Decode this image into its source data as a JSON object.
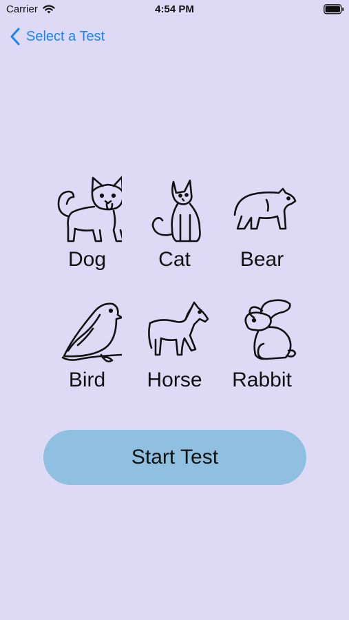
{
  "status_bar": {
    "carrier": "Carrier",
    "time": "4:54 PM"
  },
  "nav": {
    "back_label": "Select a Test"
  },
  "animals": [
    {
      "label": "Dog",
      "icon": "dog-icon"
    },
    {
      "label": "Cat",
      "icon": "cat-icon"
    },
    {
      "label": "Bear",
      "icon": "bear-icon"
    },
    {
      "label": "Bird",
      "icon": "bird-icon"
    },
    {
      "label": "Horse",
      "icon": "horse-icon"
    },
    {
      "label": "Rabbit",
      "icon": "rabbit-icon"
    }
  ],
  "start_button": {
    "label": "Start Test"
  },
  "colors": {
    "background": "#dedaf6",
    "accent": "#1a82f7",
    "button": "#8fc0e0"
  }
}
